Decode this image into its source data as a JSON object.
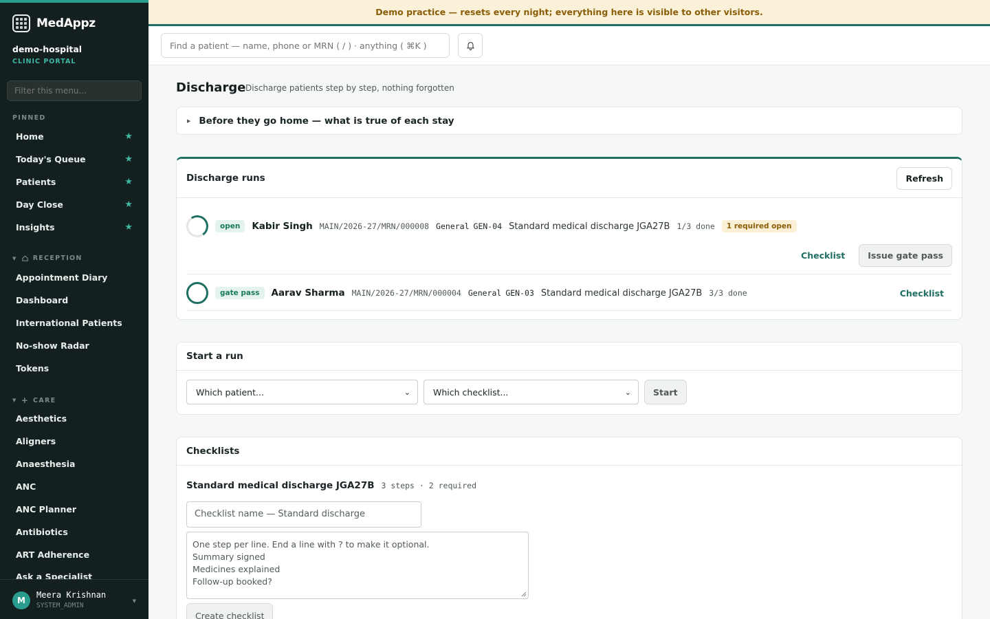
{
  "app": {
    "name": "MedAppz",
    "org": "demo-hospital",
    "org_sub": "CLINIC PORTAL"
  },
  "sidebar": {
    "filter_placeholder": "Filter this menu...",
    "pinned_label": "PINNED",
    "pinned": [
      {
        "label": "Home"
      },
      {
        "label": "Today's Queue"
      },
      {
        "label": "Patients"
      },
      {
        "label": "Day Close"
      },
      {
        "label": "Insights"
      }
    ],
    "reception_label": "RECEPTION",
    "reception": [
      {
        "label": "Appointment Diary"
      },
      {
        "label": "Dashboard"
      },
      {
        "label": "International Patients"
      },
      {
        "label": "No-show Radar"
      },
      {
        "label": "Tokens"
      }
    ],
    "care_label": "CARE",
    "care": [
      {
        "label": "Aesthetics"
      },
      {
        "label": "Aligners"
      },
      {
        "label": "Anaesthesia"
      },
      {
        "label": "ANC"
      },
      {
        "label": "ANC Planner"
      },
      {
        "label": "Antibiotics"
      },
      {
        "label": "ART Adherence"
      },
      {
        "label": "Ask a Specialist"
      }
    ],
    "user": {
      "initial": "M",
      "name": "Meera Krishnan",
      "role": "SYSTEM_ADMIN"
    }
  },
  "banner": "Demo practice — resets every night; everything here is visible to other visitors.",
  "topbar": {
    "search_placeholder": "Find a patient — name, phone or MRN ( / ) · anything ( ⌘K )"
  },
  "page": {
    "title": "Discharge",
    "subtitle": "Discharge patients step by step, nothing forgotten"
  },
  "accordion": {
    "label": "Before they go home — what is true of each stay"
  },
  "runs": {
    "title": "Discharge runs",
    "refresh": "Refresh",
    "items": [
      {
        "status": "open",
        "name": "Kabir Singh",
        "mrn": "MAIN/2026-27/MRN/000008",
        "ward": "General",
        "bed": "GEN-04",
        "checklist": "Standard medical discharge JGA27B",
        "progress": "1/3 done",
        "warning": "1 required open",
        "action": "Checklist",
        "gate_pass": "Issue gate pass",
        "completion": 0.33
      },
      {
        "status": "gate pass",
        "name": "Aarav Sharma",
        "mrn": "MAIN/2026-27/MRN/000004",
        "ward": "General",
        "bed": "GEN-03",
        "checklist": "Standard medical discharge JGA27B",
        "progress": "3/3 done",
        "action": "Checklist",
        "completion": 1.0
      }
    ]
  },
  "start_run": {
    "title": "Start a run",
    "patient_select": "Which patient...",
    "checklist_select": "Which checklist...",
    "start": "Start"
  },
  "checklists": {
    "title": "Checklists",
    "current": {
      "name": "Standard medical discharge JGA27B",
      "meta": "3 steps · 2 required"
    },
    "name_placeholder": "Checklist name — Standard discharge",
    "steps_placeholder": [
      "One step per line. End a line with ? to make it optional.",
      "Summary signed",
      "Medicines explained",
      "Follow-up booked?"
    ],
    "create": "Create checklist"
  }
}
